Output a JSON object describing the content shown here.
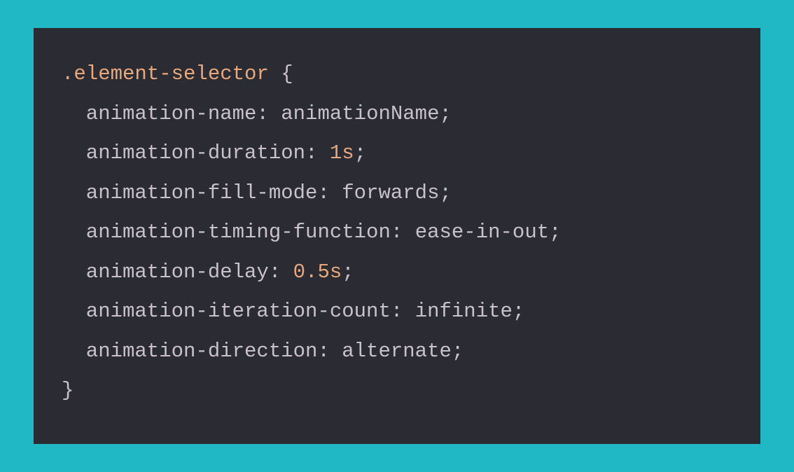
{
  "code": {
    "selector": ".element-selector",
    "open_brace": " {",
    "close_brace": "}",
    "declarations": [
      {
        "property": "animation-name",
        "value": "animationName",
        "value_type": "plain"
      },
      {
        "property": "animation-duration",
        "value": "1s",
        "value_type": "num"
      },
      {
        "property": "animation-fill-mode",
        "value": "forwards",
        "value_type": "plain"
      },
      {
        "property": "animation-timing-function",
        "value": "ease-in-out",
        "value_type": "plain"
      },
      {
        "property": "animation-delay",
        "value": "0.5s",
        "value_type": "num"
      },
      {
        "property": "animation-iteration-count",
        "value": "infinite",
        "value_type": "plain"
      },
      {
        "property": "animation-direction",
        "value": "alternate",
        "value_type": "plain"
      }
    ]
  }
}
